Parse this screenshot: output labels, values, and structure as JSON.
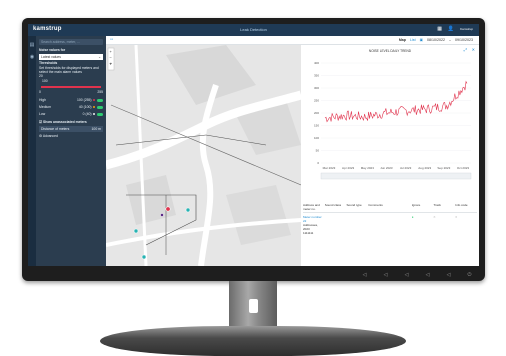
{
  "app": {
    "logo": "kamstrup",
    "title": "Leak Detection",
    "user": "Kamstrup"
  },
  "panel": {
    "search_placeholder": "Search address, meter, ...",
    "heading": "Noise values for",
    "selected_period": "Latest values",
    "thresholds_label": "Thresholds",
    "thresholds_text": "Set thresholds for displayed meters and select the main alarm values",
    "slider_min": "0",
    "slider_low": "20",
    "slider_mid": "100",
    "slider_max": "255",
    "levels": [
      {
        "label": "High",
        "value": "100 (255)",
        "color": "#e0334d"
      },
      {
        "label": "Medium",
        "value": "40 (100)",
        "color": "#f39c12"
      },
      {
        "label": "Low",
        "value": "0 (40)",
        "color": "#f1f1f1"
      }
    ],
    "unassociated_label": "Show unassociated meters",
    "distance_label": "Distance of meters",
    "distance_value": "100",
    "distance_unit": "m",
    "advanced_label": "Advanced"
  },
  "toolbar": {
    "view_map": "Map",
    "view_list": "List",
    "date_from": "08/10/2022",
    "date_sep": "–",
    "date_to": "09/10/2023"
  },
  "chart_data": {
    "type": "line",
    "title": "NOISE LEVEL DAILY TREND",
    "x": [
      "Mar 2023",
      "Apr 2023",
      "May 2023",
      "Jun 2023",
      "Jul 2023",
      "Aug 2023",
      "Sep 2023",
      "Oct 2023"
    ],
    "series": [
      {
        "values": [
          180,
          190,
          185,
          200,
          210,
          215,
          230,
          320
        ]
      }
    ],
    "ylim": [
      0,
      400
    ],
    "yticks": [
      "400",
      "350",
      "300",
      "250",
      "200",
      "150",
      "100",
      "50",
      "0"
    ],
    "color": "#e0334d",
    "legend": "none"
  },
  "table": {
    "headers": [
      "Address and meter no.",
      "Sound class",
      "Sound type",
      "Comments",
      "",
      "Ignore",
      "Track",
      "Info code"
    ],
    "rows": [
      {
        "address": "Meter number 22",
        "sub": "Addresses, 2023",
        "extra": "1111111"
      }
    ]
  },
  "bezel": {
    "buttons": [
      "◁",
      "◁",
      "◁",
      "◁",
      "◁",
      "⏻"
    ]
  }
}
